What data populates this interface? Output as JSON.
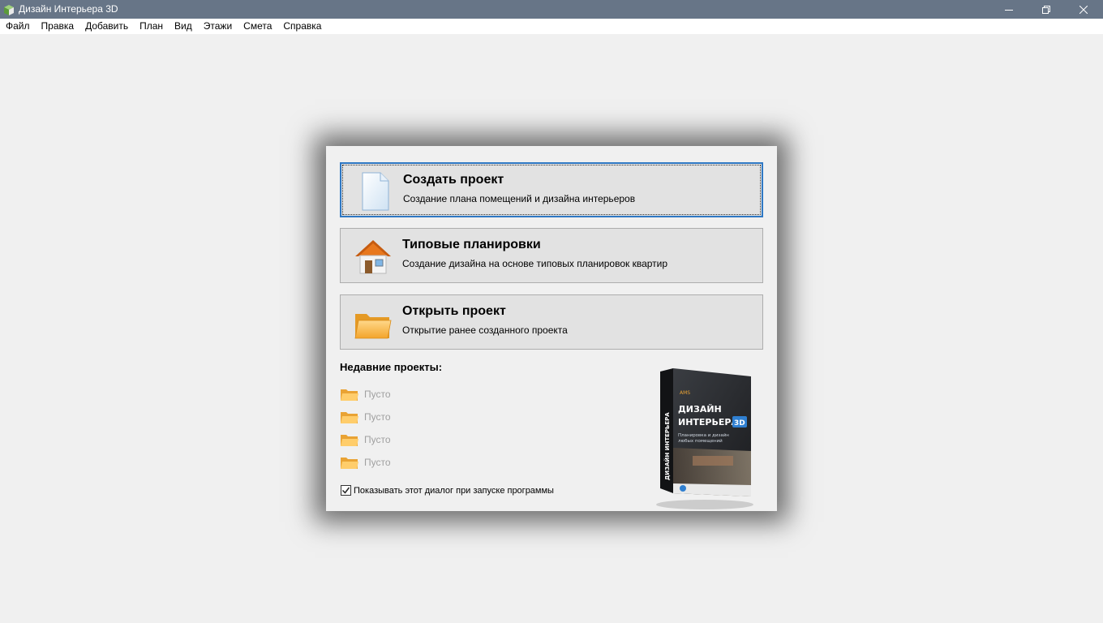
{
  "window": {
    "title": "Дизайн Интерьера 3D"
  },
  "menu": [
    "Файл",
    "Правка",
    "Добавить",
    "План",
    "Вид",
    "Этажи",
    "Смета",
    "Справка"
  ],
  "actions": [
    {
      "title": "Создать проект",
      "desc": "Создание плана помещений и дизайна интерьеров",
      "icon": "new-document-icon"
    },
    {
      "title": "Типовые планировки",
      "desc": "Создание дизайна на основе типовых планировок квартир",
      "icon": "house-icon"
    },
    {
      "title": "Открыть проект",
      "desc": "Открытие ранее созданного проекта",
      "icon": "open-folder-icon"
    }
  ],
  "recent": {
    "heading": "Недавние проекты:",
    "items": [
      "Пусто",
      "Пусто",
      "Пусто",
      "Пусто"
    ]
  },
  "show_on_startup": {
    "label": "Показывать этот диалог при запуске программы",
    "checked": true
  },
  "product_box": {
    "brand": "AMS",
    "line1": "ДИЗАЙН",
    "line2": "ИНТЕРЬЕРА",
    "badge": "3D",
    "subtitle1": "Планировка и дизайн",
    "subtitle2": "любых помещений",
    "spine": "ДИЗАЙН ИНТЕРЬЕРА"
  },
  "colors": {
    "titlebar": "#677587",
    "focus": "#2f78c4"
  }
}
